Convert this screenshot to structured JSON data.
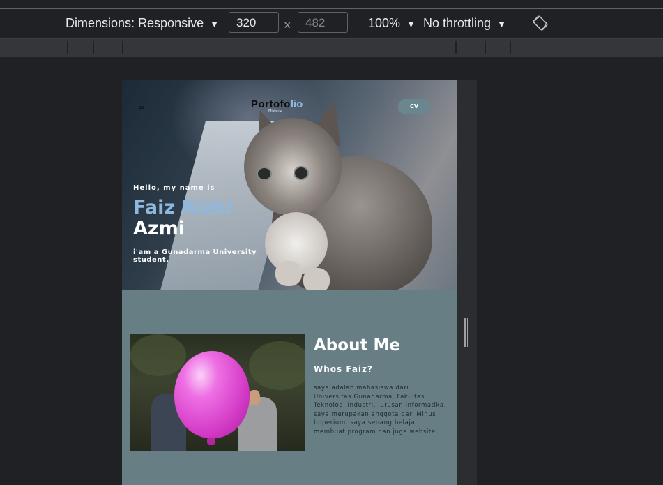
{
  "devtools": {
    "dimensions_label": "Dimensions: Responsive",
    "width_value": "320",
    "height_placeholder": "482",
    "times_symbol": "×",
    "zoom": "100%",
    "throttling": "No throttling",
    "dropdown_arrow": "▼",
    "rotate_icon": "rotate-icon"
  },
  "site": {
    "menu_icon": "≡",
    "logo_part1": "Portofo",
    "logo_part2": "lio",
    "logo_sub": "Misteriz",
    "cv_label": "CV",
    "greeting": "Hello, my name is",
    "name_first": "Faiz Rizki",
    "name_last": "Azmi",
    "tagline": "i'am a Gunadarma University student."
  },
  "about": {
    "title": "About Me",
    "subtitle": "Whos Faiz?",
    "body": "saya adalah mahasiswa dari Universitas Gunadarma, Fakultas Teknologi Industri, Jurusan Informatika. saya merupakan anggota dari Minus Imperium. saya senang belajar membuat program dan juga website."
  },
  "colors": {
    "accent_blue": "#8fb8df",
    "about_bg": "#677f84",
    "devtools_bg": "#202124"
  }
}
